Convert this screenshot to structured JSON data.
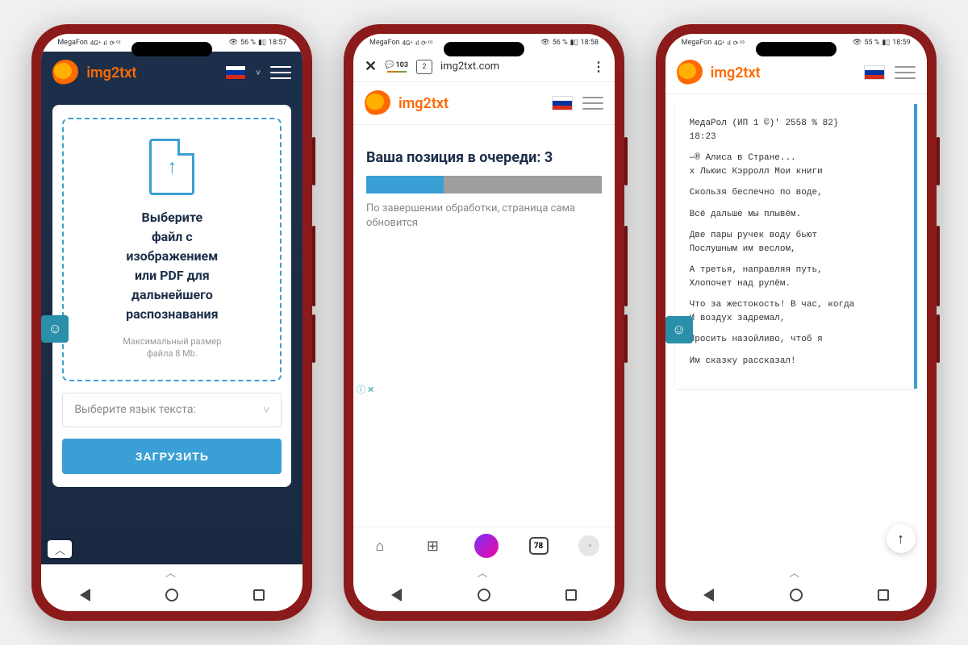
{
  "phone1": {
    "status": {
      "carrier": "MegaFon",
      "signal": "4G⁺ ‧ıl",
      "extra": "⟳ ⁽ⁱ⁾",
      "eye": "👁",
      "battery": "56 %",
      "batt_ic": "▮▯",
      "time": "18:57"
    },
    "header": {
      "brand": "img2txt",
      "chev": "˅"
    },
    "upload": {
      "l1": "Выберите",
      "l2": "файл с",
      "l3": "изображением",
      "l4": "или PDF для",
      "l5": "дальнейшего",
      "l6": "распознавания",
      "sub1": "Максимальный размер",
      "sub2": "файла 8 Mb."
    },
    "select_label": "Выберите язык текста:",
    "button": "ЗАГРУЗИТЬ",
    "expand": "︿"
  },
  "phone2": {
    "status": {
      "carrier": "MegaFon",
      "signal": "4G⁺ ‧ıl",
      "extra": "⟳ ⁽ⁱ⁾",
      "eye": "👁",
      "battery": "56 %",
      "batt_ic": "▮▯",
      "time": "18:58"
    },
    "browser": {
      "close": "✕",
      "comments": "💬 103",
      "tabs_badge": "2",
      "url": "img2txt.com",
      "menu": "⋮"
    },
    "header": {
      "brand": "img2txt"
    },
    "queue": {
      "title": "Ваша позиция в очереди: 3",
      "sub": "По завершении обработки, страница сама обновится",
      "percent": 33
    },
    "ad": {
      "i": "ⓘ",
      "x": "✕"
    },
    "bnav": {
      "home": "⌂",
      "apps": "⊞",
      "tabs": "78",
      "avatar": "◔"
    }
  },
  "phone3": {
    "status": {
      "carrier": "MegaFon",
      "signal": "4G⁺ ‧ıl",
      "extra": "⟳ ⁽ⁱ⁾",
      "eye": "👁",
      "battery": "55 %",
      "batt_ic": "▮▯",
      "time": "18:59"
    },
    "header": {
      "brand": "img2txt"
    },
    "ocr": [
      "МедаРол (ИП 1 ©)' 2558 % 82}\n18:23",
      "—® Алиса в Стране...\nх Льюис Кэрролл Мои книги",
      "Скользя беспечно по воде,",
      "Всё дальше мы плывём.",
      "Две пары ручек воду бьют\nПослушным им веслом,",
      "А третья, направляя путь,\nХлопочет над рулём.",
      "Что за жестокость! В час, когда\nИ воздух задремал,",
      "Просить назойливо, чтоб я",
      "Им сказку рассказал!"
    ],
    "scroll": "↑"
  },
  "navsep": "︿"
}
